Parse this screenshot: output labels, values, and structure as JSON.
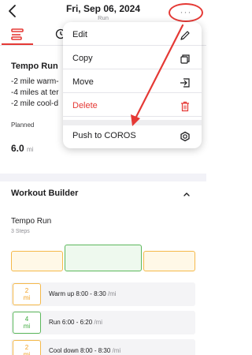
{
  "header": {
    "date": "Fri, Sep 06, 2024",
    "subtitle": "Run",
    "more_label": "···"
  },
  "workout": {
    "title": "Tempo Run",
    "description": [
      "-2 mile warm-",
      "-4 miles at ter",
      "-2 mile cool-d"
    ],
    "planned_label": "Planned",
    "planned_value": "6.0",
    "planned_unit": "mi"
  },
  "builder": {
    "title": "Workout Builder",
    "name": "Tempo Run",
    "steps_count": "3 Steps",
    "steps": [
      {
        "badge_value": "2",
        "badge_unit": "mi",
        "label": "Warm up",
        "pace": "8:00 - 8:30",
        "pace_unit": "/mi",
        "type": "warm"
      },
      {
        "badge_value": "4",
        "badge_unit": "mi",
        "label": "Run",
        "pace": "6:00 - 6:20",
        "pace_unit": "/mi",
        "type": "run"
      },
      {
        "badge_value": "2",
        "badge_unit": "mi",
        "label": "Cool down",
        "pace": "8:00 - 8:30",
        "pace_unit": "/mi",
        "type": "warm"
      }
    ]
  },
  "menu": {
    "items": [
      {
        "label": "Edit",
        "icon": "pencil-icon"
      },
      {
        "label": "Copy",
        "icon": "copy-icon"
      },
      {
        "label": "Move",
        "icon": "move-icon"
      },
      {
        "label": "Delete",
        "icon": "trash-icon"
      },
      {
        "label": "Push to COROS",
        "icon": "coros-icon"
      }
    ]
  },
  "colors": {
    "accent": "#e53935",
    "warm": "#f5b94a",
    "run": "#5cb85c"
  }
}
